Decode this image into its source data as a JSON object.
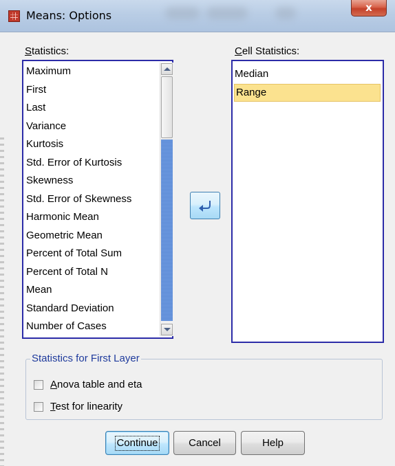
{
  "window": {
    "title": "Means: Options",
    "close_label": "x"
  },
  "statistics": {
    "label_prefix": "",
    "label_mnemonic": "S",
    "label_rest": "tatistics:",
    "items": [
      "Maximum",
      "First",
      "Last",
      "Variance",
      "Kurtosis",
      "Std. Error of Kurtosis",
      "Skewness",
      "Std. Error of Skewness",
      "Harmonic Mean",
      "Geometric Mean",
      "Percent of Total Sum",
      "Percent of Total N",
      "Mean",
      "Standard Deviation",
      "Number of Cases"
    ]
  },
  "cell_statistics": {
    "label_mnemonic": "C",
    "label_rest": "ell Statistics:",
    "items": [
      "Median",
      "Range"
    ],
    "selected": "Range"
  },
  "first_layer": {
    "title": "Statistics for First Layer",
    "anova_mnemonic": "A",
    "anova_rest": "nova table and eta",
    "anova_checked": false,
    "linearity_mnemonic": "T",
    "linearity_rest": "est for linearity",
    "linearity_checked": false
  },
  "buttons": {
    "continue": "Continue",
    "cancel": "Cancel",
    "help": "Help"
  },
  "colors": {
    "selection": "#fbe28f",
    "list_border": "#2b2ba8",
    "group_title": "#1e3a9c"
  },
  "icons": {
    "move": "arrow-left-curved-icon",
    "app": "spss-table-icon",
    "close": "close-icon"
  }
}
